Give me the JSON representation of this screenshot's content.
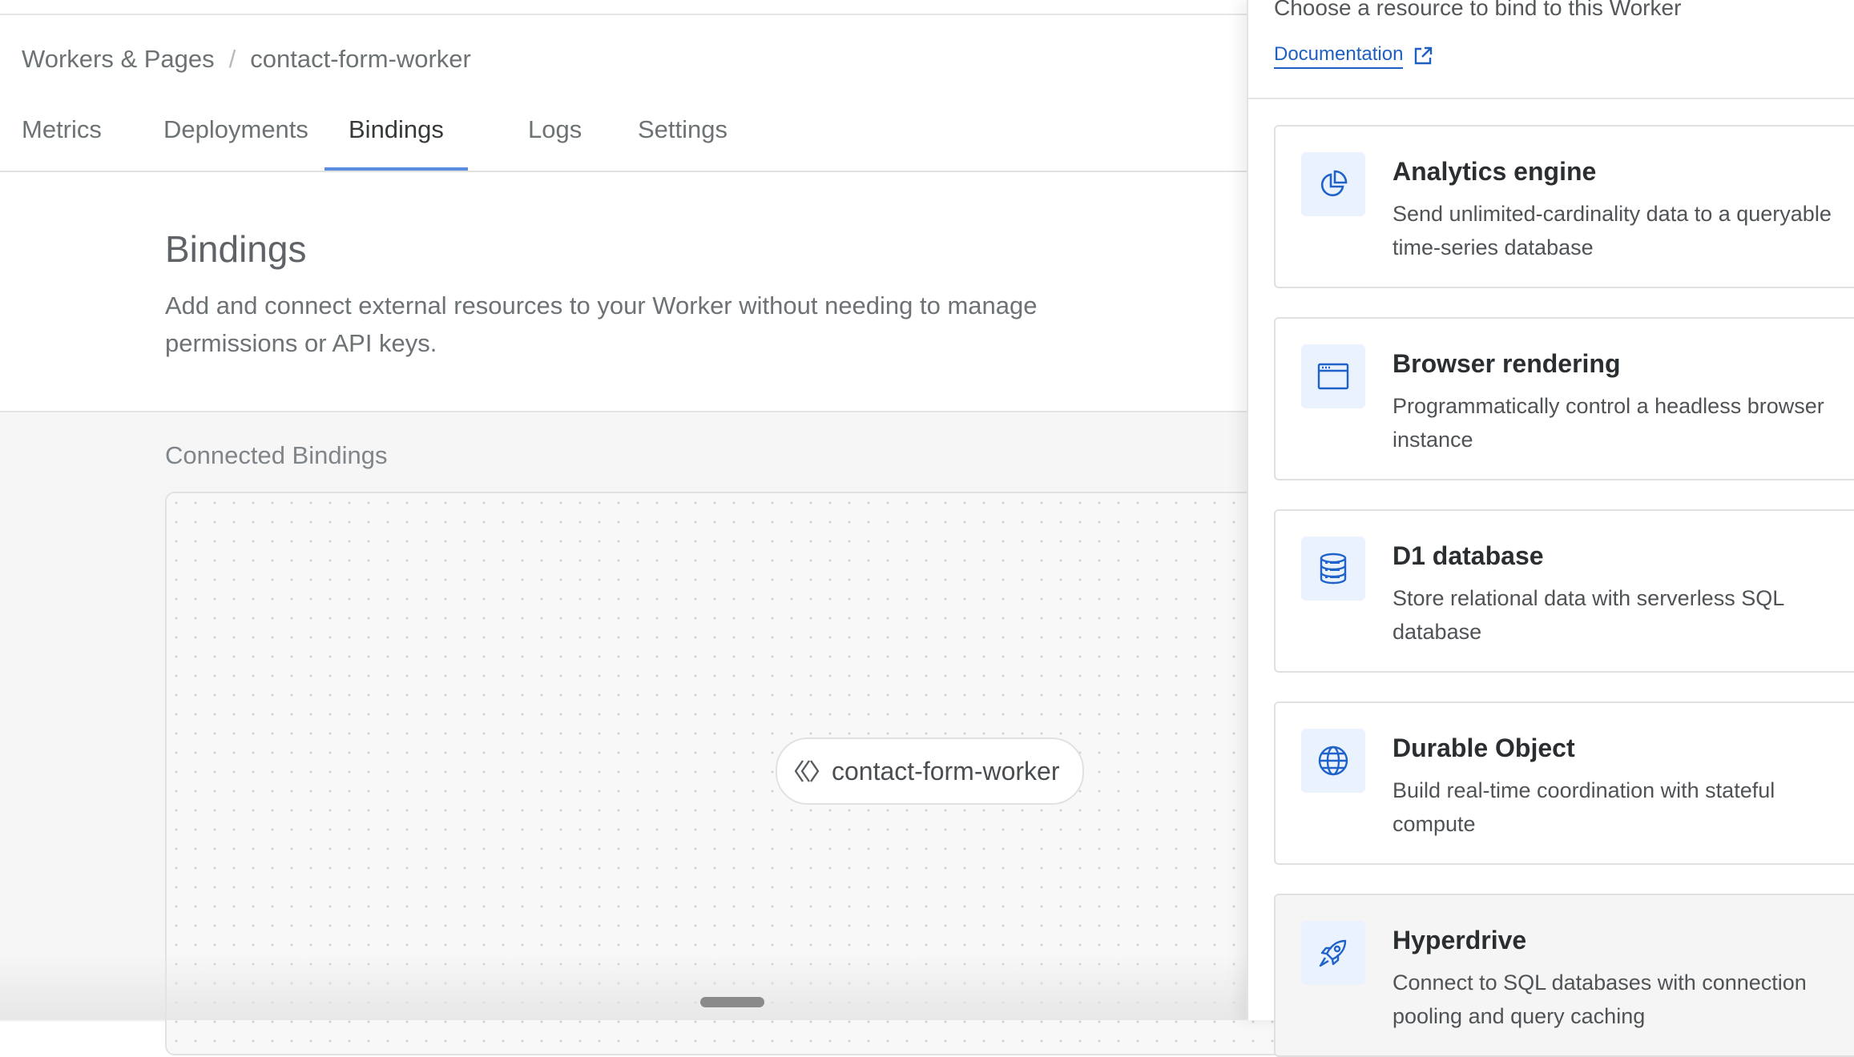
{
  "breadcrumb": {
    "parent": "Workers & Pages",
    "separator": "/",
    "current": "contact-form-worker"
  },
  "tabs": [
    {
      "label": "Metrics",
      "active": false
    },
    {
      "label": "Deployments",
      "active": false
    },
    {
      "label": "Bindings",
      "active": true
    },
    {
      "label": "Logs",
      "active": false
    },
    {
      "label": "Settings",
      "active": false
    }
  ],
  "bindings_section": {
    "title": "Bindings",
    "description": "Add and connect external resources to your Worker without needing to manage permissions or API keys."
  },
  "connected": {
    "title": "Connected Bindings",
    "worker_node": {
      "label": "contact-form-worker",
      "icon": "worker-code-icon"
    }
  },
  "panel": {
    "subtitle": "Choose a resource to bind to this Worker",
    "doc_link": {
      "label": "Documentation",
      "icon": "external-link-icon"
    },
    "resources": [
      {
        "title": "Analytics engine",
        "description": "Send unlimited-cardinality data to a queryable time-series database",
        "icon": "pie-chart-icon"
      },
      {
        "title": "Browser rendering",
        "description": "Programmatically control a headless browser instance",
        "icon": "browser-window-icon"
      },
      {
        "title": "D1 database",
        "description": "Store relational data with serverless SQL database",
        "icon": "database-icon"
      },
      {
        "title": "Durable Object",
        "description": "Build real-time coordination with stateful compute",
        "icon": "globe-icon"
      },
      {
        "title": "Hyperdrive",
        "description": "Connect to SQL databases with connection pooling and query caching",
        "icon": "rocket-icon"
      }
    ]
  },
  "colors": {
    "accent": "#1e5fc2",
    "tab_underline": "#5b8ee0",
    "icon_bg": "#eaf2fd"
  }
}
